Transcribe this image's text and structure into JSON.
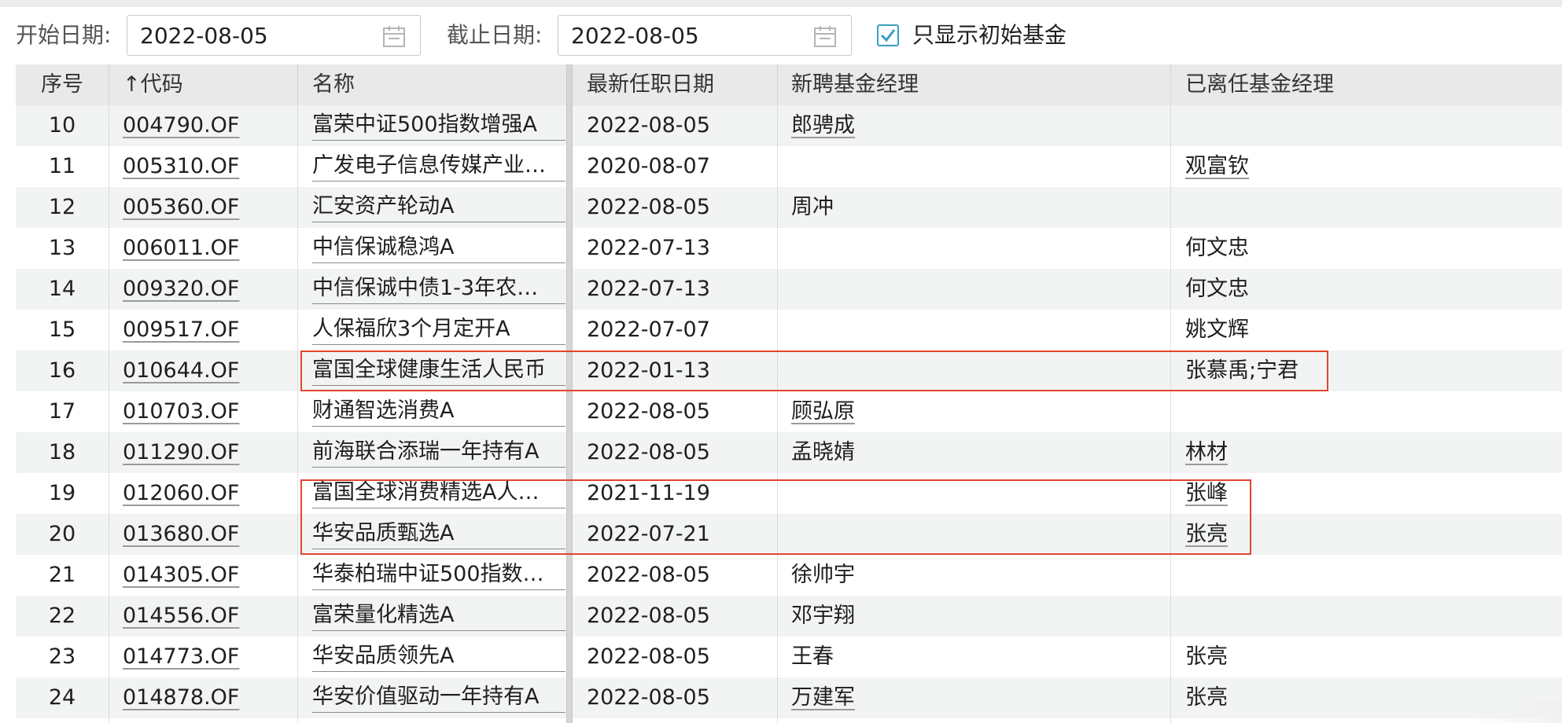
{
  "filters": {
    "start_label": "开始日期:",
    "start_value": "2022-08-05",
    "end_label": "截止日期:",
    "end_value": "2022-08-05",
    "only_initial_label": "只显示初始基金",
    "only_initial_checked": true
  },
  "table": {
    "headers": {
      "no": "序号",
      "code": "↑代码",
      "name": "名称",
      "date": "最新任职日期",
      "new_manager": "新聘基金经理",
      "left_manager": "已离任基金经理"
    },
    "rows": [
      {
        "no": "10",
        "code": "004790.OF",
        "name": "富荣中证500指数增强A",
        "date": "2022-08-05",
        "new_manager": "郎骋成",
        "left_manager": ""
      },
      {
        "no": "11",
        "code": "005310.OF",
        "name": "广发电子信息传媒产业…",
        "date": "2020-08-07",
        "new_manager": "",
        "left_manager": "观富钦"
      },
      {
        "no": "12",
        "code": "005360.OF",
        "name": "汇安资产轮动A",
        "date": "2022-08-05",
        "new_manager": "周冲",
        "left_manager": ""
      },
      {
        "no": "13",
        "code": "006011.OF",
        "name": "中信保诚稳鸿A",
        "date": "2022-07-13",
        "new_manager": "",
        "left_manager": "何文忠"
      },
      {
        "no": "14",
        "code": "009320.OF",
        "name": "中信保诚中债1-3年农…",
        "date": "2022-07-13",
        "new_manager": "",
        "left_manager": "何文忠"
      },
      {
        "no": "15",
        "code": "009517.OF",
        "name": "人保福欣3个月定开A",
        "date": "2022-07-07",
        "new_manager": "",
        "left_manager": "姚文辉"
      },
      {
        "no": "16",
        "code": "010644.OF",
        "name": "富国全球健康生活人民币",
        "date": "2022-01-13",
        "new_manager": "",
        "left_manager": "张慕禹;宁君"
      },
      {
        "no": "17",
        "code": "010703.OF",
        "name": "财通智选消费A",
        "date": "2022-08-05",
        "new_manager": "顾弘原",
        "left_manager": ""
      },
      {
        "no": "18",
        "code": "011290.OF",
        "name": "前海联合添瑞一年持有A",
        "date": "2022-08-05",
        "new_manager": "孟晓婧",
        "left_manager": "林材"
      },
      {
        "no": "19",
        "code": "012060.OF",
        "name": "富国全球消费精选A人…",
        "date": "2021-11-19",
        "new_manager": "",
        "left_manager": "张峰"
      },
      {
        "no": "20",
        "code": "013680.OF",
        "name": "华安品质甄选A",
        "date": "2022-07-21",
        "new_manager": "",
        "left_manager": "张亮"
      },
      {
        "no": "21",
        "code": "014305.OF",
        "name": "华泰柏瑞中证500指数…",
        "date": "2022-08-05",
        "new_manager": "徐帅宇",
        "left_manager": ""
      },
      {
        "no": "22",
        "code": "014556.OF",
        "name": "富荣量化精选A",
        "date": "2022-08-05",
        "new_manager": "邓宇翔",
        "left_manager": ""
      },
      {
        "no": "23",
        "code": "014773.OF",
        "name": "华安品质领先A",
        "date": "2022-08-05",
        "new_manager": "王春",
        "left_manager": "张亮"
      },
      {
        "no": "24",
        "code": "014878.OF",
        "name": "华安价值驱动一年持有A",
        "date": "2022-08-05",
        "new_manager": "万建军",
        "left_manager": "张亮"
      }
    ]
  },
  "colors": {
    "highlight_border": "#e2452e",
    "checkbox": "#3a9fc0",
    "header_bg": "#e9e9e9",
    "alt_row_bg": "#f2f4f4"
  },
  "icons": {
    "calendar": "calendar-icon",
    "check": "check-icon"
  }
}
